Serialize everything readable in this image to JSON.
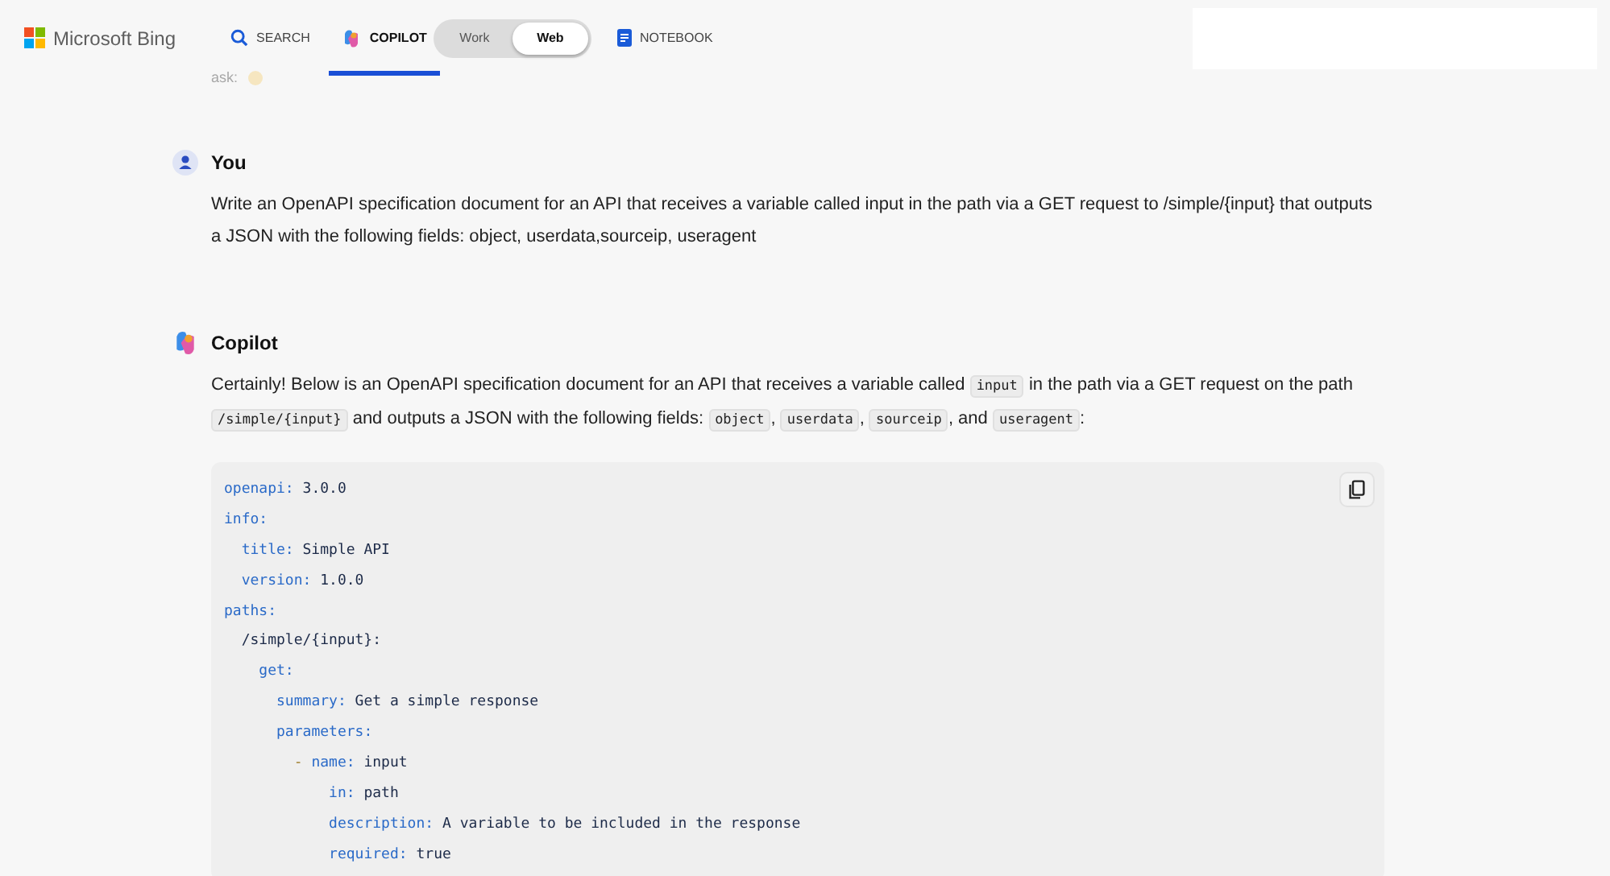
{
  "header": {
    "brand": "Microsoft Bing",
    "tabs": [
      {
        "kind": "search",
        "label": "SEARCH",
        "selected": false
      },
      {
        "kind": "copilot",
        "label": "COPILOT",
        "selected": true
      }
    ],
    "mode_toggle": [
      {
        "label": "Work",
        "selected": false
      },
      {
        "label": "Web",
        "selected": true
      }
    ],
    "notebook": {
      "label": "NOTEBOOK"
    }
  },
  "faded_text": "ask:",
  "messages": [
    {
      "author": "You",
      "kind": "user",
      "paragraphs": [
        [
          {
            "kind": "text",
            "text": "Write an OpenAPI specification document for an API that receives a variable called input in the path via a GET request to /simple/{input} that outputs a JSON with the following fields: object, userdata,sourceip, useragent"
          }
        ]
      ]
    },
    {
      "author": "Copilot",
      "kind": "bot",
      "paragraphs": [
        [
          {
            "kind": "text",
            "text": "Certainly! Below is an OpenAPI specification document for an API that receives a variable called "
          },
          {
            "kind": "code",
            "text": "input"
          },
          {
            "kind": "text",
            "text": " in the path via a GET request on the path "
          },
          {
            "kind": "code",
            "text": "/simple/{input}"
          },
          {
            "kind": "text",
            "text": " and outputs a JSON with the following fields: "
          },
          {
            "kind": "code",
            "text": "object"
          },
          {
            "kind": "text",
            "text": ", "
          },
          {
            "kind": "code",
            "text": "userdata"
          },
          {
            "kind": "text",
            "text": ", "
          },
          {
            "kind": "code",
            "text": "sourceip"
          },
          {
            "kind": "text",
            "text": ", and "
          },
          {
            "kind": "code",
            "text": "useragent"
          },
          {
            "kind": "text",
            "text": ":"
          }
        ]
      ],
      "code": [
        {
          "key": "openapi:",
          "value": "3.0.0"
        },
        {
          "key": "info:",
          "children": [
            {
              "key": "title:",
              "value": "Simple API"
            },
            {
              "key": "version:",
              "value": "1.0.0"
            }
          ]
        },
        {
          "key": "paths:",
          "children": [
            {
              "value": "/simple/{input}:",
              "children": [
                {
                  "key": "get:",
                  "children": [
                    {
                      "key": "summary:",
                      "value": "Get a simple response"
                    },
                    {
                      "key": "parameters:",
                      "children": [
                        {
                          "dash": "-",
                          "key": "name:",
                          "value": "input",
                          "children": [
                            {
                              "key": "in:",
                              "value": "path"
                            },
                            {
                              "key": "description:",
                              "value": "A variable to be included in the response"
                            },
                            {
                              "key": "required:",
                              "value": "true"
                            }
                          ]
                        }
                      ]
                    }
                  ]
                }
              ]
            }
          ]
        }
      ]
    }
  ]
}
